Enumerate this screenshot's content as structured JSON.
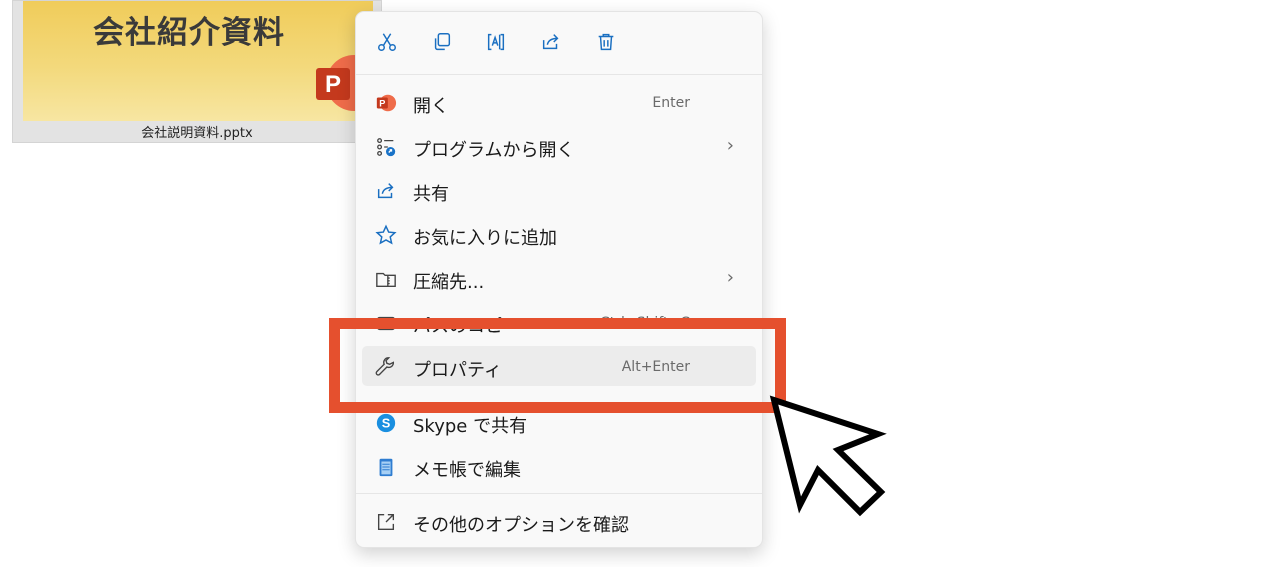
{
  "file": {
    "thumbnail_title": "会社紹介資料",
    "badge_letter": "P",
    "name": "会社説明資料.pptx"
  },
  "toolbar": [
    {
      "name": "cut-icon"
    },
    {
      "name": "copy-icon"
    },
    {
      "name": "rename-icon"
    },
    {
      "name": "share-icon"
    },
    {
      "name": "delete-icon"
    }
  ],
  "menu": {
    "items": [
      {
        "label": "開く",
        "shortcut": "Enter",
        "icon": "powerpoint-icon"
      },
      {
        "label": "プログラムから開く",
        "submenu": "›",
        "icon": "open-with-icon"
      },
      {
        "label": "共有",
        "icon": "share-icon"
      },
      {
        "label": "お気に入りに追加",
        "icon": "star-icon"
      },
      {
        "label": "圧縮先...",
        "submenu": "›",
        "icon": "zip-folder-icon"
      },
      {
        "label": "パスのコピー",
        "shortcut": "Ctrl+Shift+C",
        "icon": "copy-path-icon"
      },
      {
        "label": "プロパティ",
        "shortcut": "Alt+Enter",
        "icon": "wrench-icon"
      },
      {
        "label": "Skype で共有",
        "icon": "skype-icon"
      },
      {
        "label": "メモ帳で編集",
        "icon": "notepad-icon"
      },
      {
        "label": "その他のオプションを確認",
        "icon": "more-options-icon"
      }
    ]
  },
  "colors": {
    "highlight_box": "#e5502e",
    "powerpoint": "#d24726",
    "accent_blue": "#1a73c8"
  }
}
